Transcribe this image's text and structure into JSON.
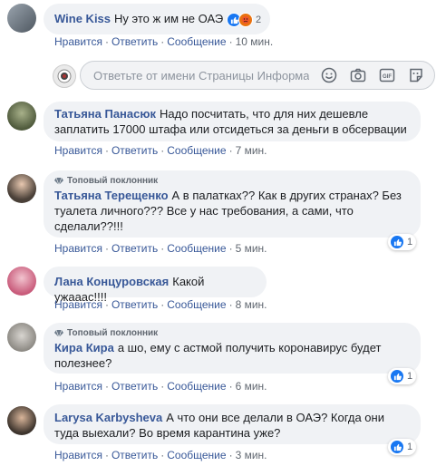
{
  "comments": [
    {
      "author": "Wine Kiss",
      "text": "Ну это ж им не ОАЭ",
      "top_fan": "",
      "reactions_count": "2",
      "time": "10 мин."
    },
    {
      "author": "Татьяна Панасюк",
      "text": "Надо посчитать, что для них дешевле заплатить 17000 штафа или отсидеться за деньги в обсервации",
      "top_fan": "",
      "reactions_count": "",
      "time": "7 мин."
    },
    {
      "author": "Татьяна Терещенко",
      "text": "А в палатках?? Как в других странах? Без туалета личного??? Все у нас требования, а сами, что сделали??!!!",
      "top_fan": "Топовый поклонник",
      "reactions_count": "1",
      "time": "5 мин."
    },
    {
      "author": "Лана Концуровская",
      "text": "Какой ужааас!!!!",
      "top_fan": "",
      "reactions_count": "",
      "time": "8 мин."
    },
    {
      "author": "Кира Кира",
      "text": "а шо, ему с астмой получить коронавирус будет полезнее?",
      "top_fan": "Топовый поклонник",
      "reactions_count": "1",
      "time": "6 мин."
    },
    {
      "author": "Larysa Karbysheva",
      "text": "А что они все делали в ОАЭ? Когда они туда выехали? Во время карантина уже?",
      "top_fan": "",
      "reactions_count": "1",
      "time": "3 мин."
    }
  ],
  "actions": {
    "like": "Нравится",
    "reply": "Ответить",
    "message": "Сообщение",
    "separator": "·"
  },
  "reply_box": {
    "placeholder": "Ответьте от имени Страницы Информат..."
  },
  "colors": {
    "link": "#385898",
    "bubble": "#f0f2f5",
    "like_blue": "#1877f2"
  },
  "icons": [
    "smiley-icon",
    "camera-icon",
    "gif-icon",
    "sticker-icon",
    "like-reaction-icon",
    "haha-reaction-icon",
    "top-fan-icon"
  ]
}
